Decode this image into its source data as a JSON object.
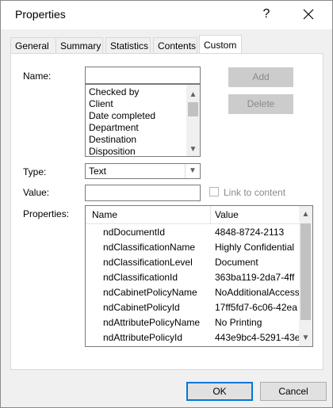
{
  "window": {
    "title": "Properties",
    "help_glyph": "?"
  },
  "tabs": [
    {
      "label": "General"
    },
    {
      "label": "Summary"
    },
    {
      "label": "Statistics"
    },
    {
      "label": "Contents"
    },
    {
      "label": "Custom",
      "active": true
    }
  ],
  "custom": {
    "name_label": "Name:",
    "name_value": "",
    "add_label": "Add",
    "delete_label": "Delete",
    "name_options": [
      "Checked by",
      "Client",
      "Date completed",
      "Department",
      "Destination",
      "Disposition"
    ],
    "type_label": "Type:",
    "type_value": "Text",
    "value_label": "Value:",
    "value_value": "",
    "link_label": "Link to content",
    "properties_label": "Properties:",
    "columns": {
      "name": "Name",
      "value": "Value"
    },
    "properties": [
      {
        "name": "ndDocumentId",
        "value": "4848-8724-2113"
      },
      {
        "name": "ndClassificationName",
        "value": "Highly Confidential"
      },
      {
        "name": "ndClassificationLevel",
        "value": "Document"
      },
      {
        "name": "ndClassificationId",
        "value": "363ba119-2da7-4ff"
      },
      {
        "name": "ndCabinetPolicyName",
        "value": "NoAdditionalAccess"
      },
      {
        "name": "ndCabinetPolicyId",
        "value": "17ff5fd7-6c06-42ea"
      },
      {
        "name": "ndAttributePolicyName",
        "value": "No Printing"
      },
      {
        "name": "ndAttributePolicyId",
        "value": "443e9bc4-5291-43e"
      }
    ]
  },
  "footer": {
    "ok_label": "OK",
    "cancel_label": "Cancel"
  },
  "colors": {
    "accent": "#0078d7",
    "panel": "#f0f0f0",
    "disabled_button": "#cccccc"
  }
}
